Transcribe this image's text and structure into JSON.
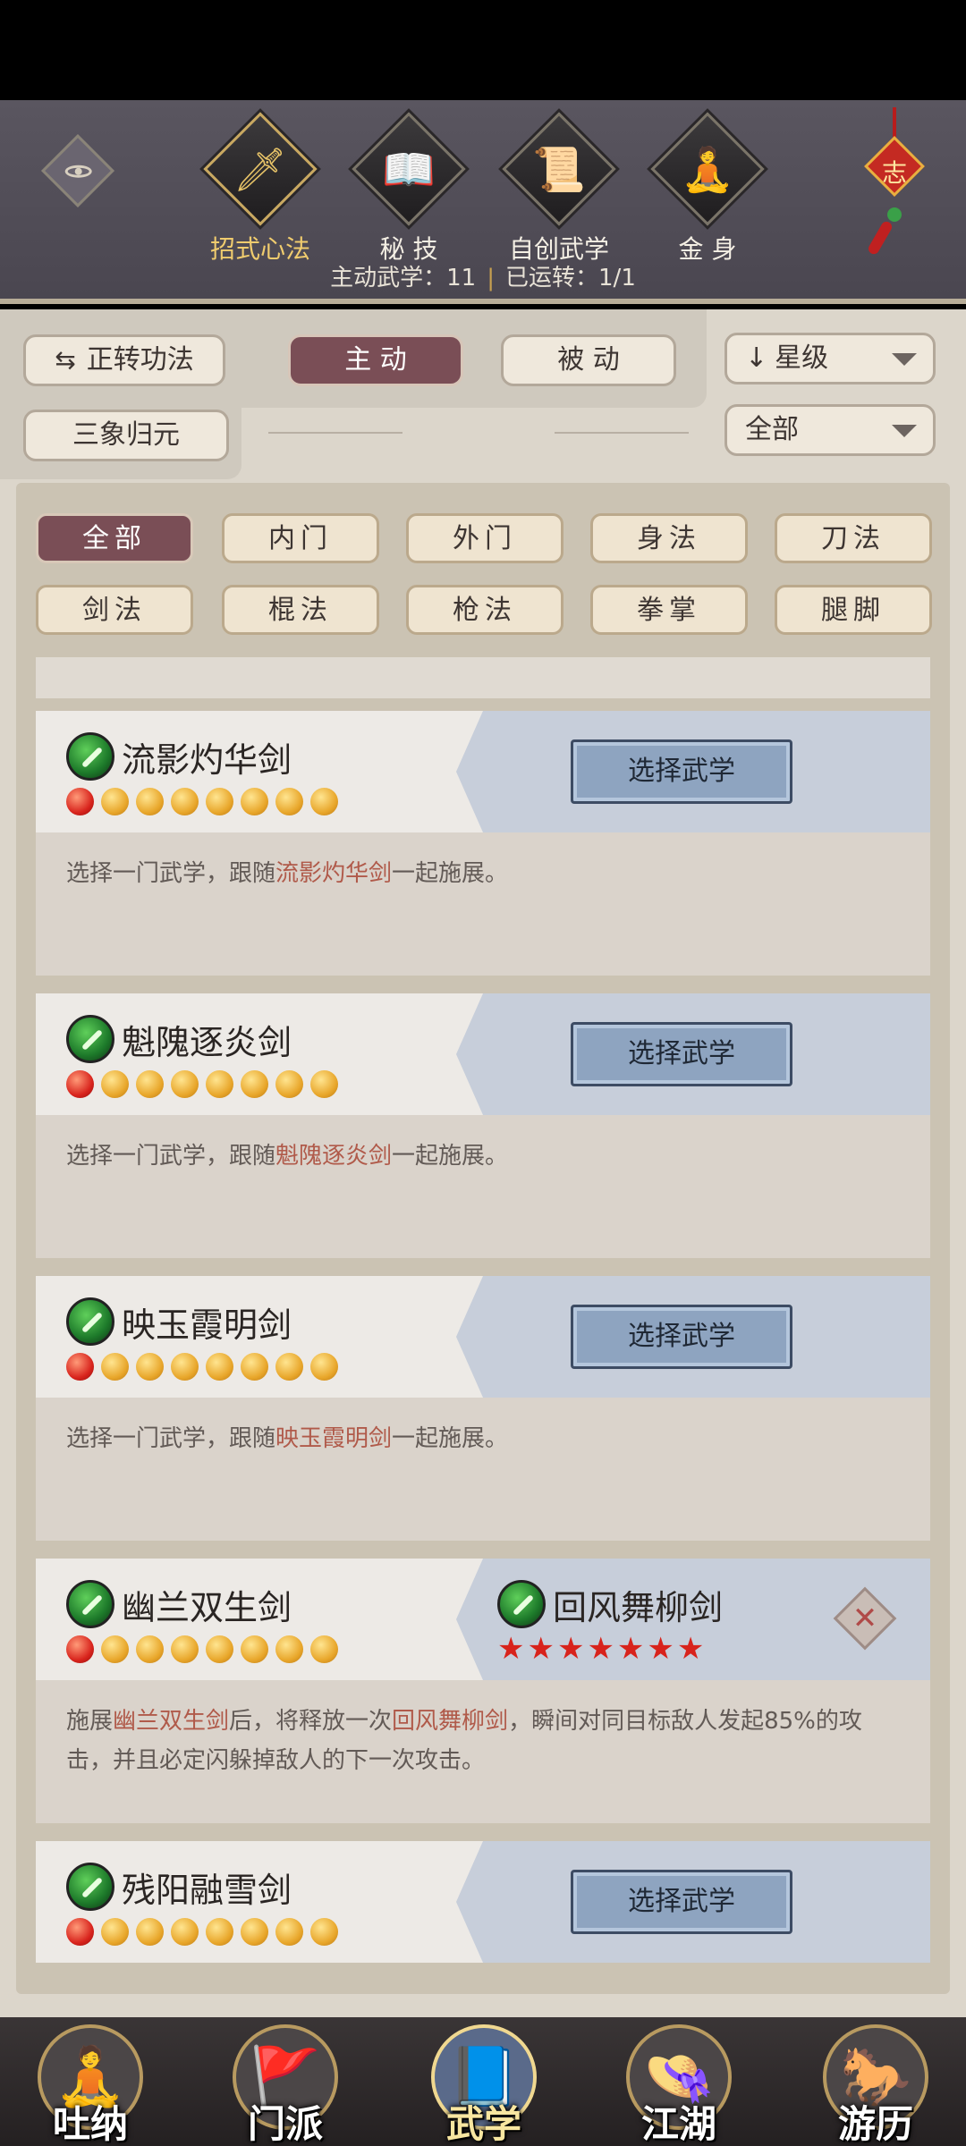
{
  "header": {
    "tabs": [
      {
        "label": "招式心法",
        "glyph": "🗡",
        "icon": "sword-icon"
      },
      {
        "label": "秘 技",
        "glyph": "📖",
        "icon": "book-icon"
      },
      {
        "label": "自创武学",
        "glyph": "📜",
        "icon": "scroll-icon"
      },
      {
        "label": "金 身",
        "glyph": "🧘",
        "icon": "meditation-icon"
      }
    ],
    "knot_char": "志",
    "stats": {
      "active_label": "主动武学：",
      "active_value": "11",
      "separator": "|",
      "running_label": "已运转：",
      "running_value": "1/1"
    }
  },
  "filters": {
    "reverse_button": "正转功法",
    "mode_tabs": [
      "主 动",
      "被 动"
    ],
    "sort_select": "星级",
    "sanxiang_button": "三象归元",
    "scope_select": "全部"
  },
  "categories": [
    "全部",
    "内门",
    "外门",
    "身法",
    "刀法",
    "剑法",
    "棍法",
    "枪法",
    "拳掌",
    "腿脚"
  ],
  "choose_label": "选择武学",
  "desc_tpl": {
    "prefix": "选择一门武学，跟随",
    "suffix": "一起施展。"
  },
  "skills": [
    {
      "name": "流影灼华剑",
      "level": 1,
      "max_level": 8
    },
    {
      "name": "魁隗逐炎剑",
      "level": 1,
      "max_level": 8
    },
    {
      "name": "映玉霞明剑",
      "level": 1,
      "max_level": 8
    },
    {
      "name": "幽兰双生剑",
      "level": 1,
      "max_level": 8,
      "combo": {
        "name": "回风舞柳剑",
        "stars": "★★★★★★★",
        "desc_1": "施展",
        "desc_2": "后，将释放一次",
        "desc_3": "，瞬间对同目标敌人发起85%的攻击，并且必定闪躲掉敌人的下一次攻击。"
      }
    },
    {
      "name": "残阳融雪剑",
      "level": 1,
      "max_level": 8
    }
  ],
  "bottom_nav": [
    {
      "label": "吐纳",
      "art": "🧘"
    },
    {
      "label": "门派",
      "art": "🚩"
    },
    {
      "label": "武学",
      "art": "📘"
    },
    {
      "label": "江湖",
      "art": "👒"
    },
    {
      "label": "游历",
      "art": "🐎"
    }
  ],
  "colors": {
    "accent_active": "#7a4e56",
    "highlight_text": "#b05a4a",
    "choose_button": "#8ea4c0"
  }
}
